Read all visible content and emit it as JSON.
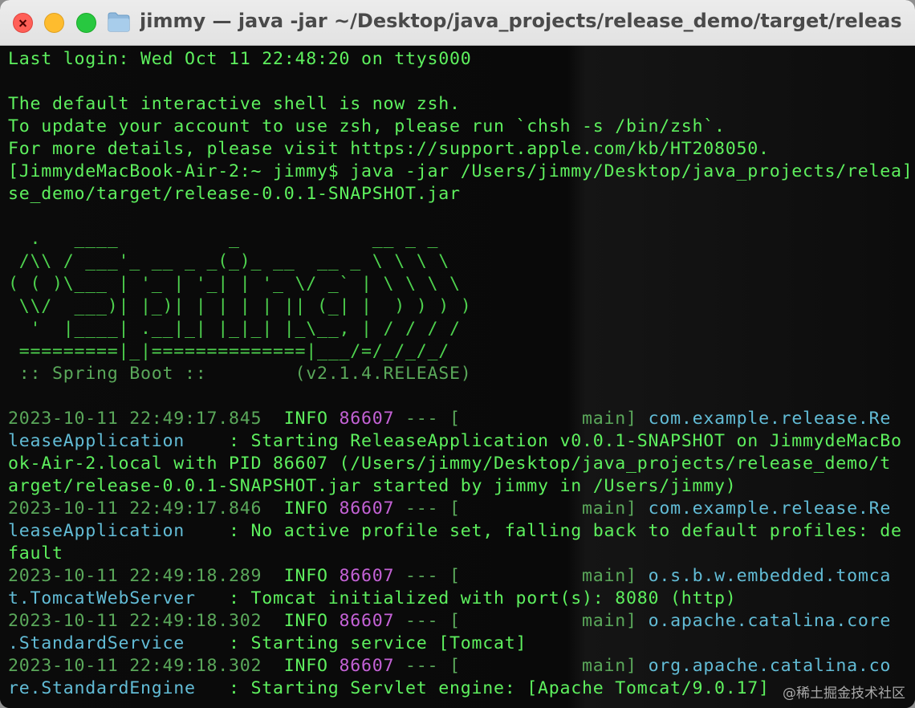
{
  "window": {
    "title": "jimmy — java -jar ~/Desktop/java_projects/release_demo/target/release-...",
    "controls": [
      "close",
      "minimize",
      "zoom"
    ]
  },
  "terminal": {
    "line_groups": [
      [
        {
          "t": "Last login: Wed Oct 11 22:48:20 on ttys000",
          "c": "green"
        }
      ],
      [
        {
          "t": "",
          "c": "green"
        }
      ],
      [
        {
          "t": "The default interactive shell is now zsh.",
          "c": "green"
        }
      ],
      [
        {
          "t": "To update your account to use zsh, please run `chsh -s /bin/zsh`.",
          "c": "green"
        }
      ],
      [
        {
          "t": "For more details, please visit https://support.apple.com/kb/HT208050.",
          "c": "green"
        }
      ],
      [
        {
          "t": "[JimmydeMacBook-Air-2:~ jimmy$ java -jar /Users/jimmy/Desktop/java_projects/relea]",
          "c": "green"
        }
      ],
      [
        {
          "t": "se_demo/target/release-0.0.1-SNAPSHOT.jar",
          "c": "green"
        }
      ],
      [
        {
          "t": "",
          "c": "green"
        }
      ],
      [
        {
          "t": "  .   ____          _            __ _ _",
          "c": "banner"
        }
      ],
      [
        {
          "t": " /\\\\ / ___'_ __ _ _(_)_ __  __ _ \\ \\ \\ \\",
          "c": "banner"
        }
      ],
      [
        {
          "t": "( ( )\\___ | '_ | '_| | '_ \\/ _` | \\ \\ \\ \\",
          "c": "banner"
        }
      ],
      [
        {
          "t": " \\\\/  ___)| |_)| | | | | || (_| |  ) ) ) )",
          "c": "banner"
        }
      ],
      [
        {
          "t": "  '  |____| .__|_| |_|_| |_\\__, | / / / /",
          "c": "banner"
        }
      ],
      [
        {
          "t": " =========|_|==============|___/=/_/_/_/",
          "c": "banner"
        }
      ],
      [
        {
          "t": " :: Spring Boot ::        (v2.1.4.RELEASE)",
          "c": "dim"
        }
      ],
      [
        {
          "t": "",
          "c": "green"
        }
      ],
      [
        {
          "t": "2023-10-11 22:49:17.845  ",
          "c": "dim"
        },
        {
          "t": "INFO ",
          "c": "green"
        },
        {
          "t": "86607",
          "c": "purple"
        },
        {
          "t": " --- [           main] ",
          "c": "dim"
        },
        {
          "t": "com.example.release.Re",
          "c": "cyan"
        }
      ],
      [
        {
          "t": "leaseApplication   ",
          "c": "cyan"
        },
        {
          "t": " : Starting ReleaseApplication v0.0.1-SNAPSHOT on JimmydeMacBo",
          "c": "green"
        }
      ],
      [
        {
          "t": "ok-Air-2.local with PID 86607 (/Users/jimmy/Desktop/java_projects/release_demo/t",
          "c": "green"
        }
      ],
      [
        {
          "t": "arget/release-0.0.1-SNAPSHOT.jar started by jimmy in /Users/jimmy)",
          "c": "green"
        }
      ],
      [
        {
          "t": "2023-10-11 22:49:17.846  ",
          "c": "dim"
        },
        {
          "t": "INFO ",
          "c": "green"
        },
        {
          "t": "86607",
          "c": "purple"
        },
        {
          "t": " --- [           main] ",
          "c": "dim"
        },
        {
          "t": "com.example.release.Re",
          "c": "cyan"
        }
      ],
      [
        {
          "t": "leaseApplication   ",
          "c": "cyan"
        },
        {
          "t": " : No active profile set, falling back to default profiles: de",
          "c": "green"
        }
      ],
      [
        {
          "t": "fault",
          "c": "green"
        }
      ],
      [
        {
          "t": "2023-10-11 22:49:18.289  ",
          "c": "dim"
        },
        {
          "t": "INFO ",
          "c": "green"
        },
        {
          "t": "86607",
          "c": "purple"
        },
        {
          "t": " --- [           main] ",
          "c": "dim"
        },
        {
          "t": "o.s.b.w.embedded.tomca",
          "c": "cyan"
        }
      ],
      [
        {
          "t": "t.TomcatWebServer  ",
          "c": "cyan"
        },
        {
          "t": " : Tomcat initialized with port(s): 8080 (http)",
          "c": "green"
        }
      ],
      [
        {
          "t": "2023-10-11 22:49:18.302  ",
          "c": "dim"
        },
        {
          "t": "INFO ",
          "c": "green"
        },
        {
          "t": "86607",
          "c": "purple"
        },
        {
          "t": " --- [           main] ",
          "c": "dim"
        },
        {
          "t": "o.apache.catalina.core",
          "c": "cyan"
        }
      ],
      [
        {
          "t": ".StandardService   ",
          "c": "cyan"
        },
        {
          "t": " : Starting service [Tomcat]",
          "c": "green"
        }
      ],
      [
        {
          "t": "2023-10-11 22:49:18.302  ",
          "c": "dim"
        },
        {
          "t": "INFO ",
          "c": "green"
        },
        {
          "t": "86607",
          "c": "purple"
        },
        {
          "t": " --- [           main] ",
          "c": "dim"
        },
        {
          "t": "org.apache.catalina.co",
          "c": "cyan"
        }
      ],
      [
        {
          "t": "re.StandardEngine  ",
          "c": "cyan"
        },
        {
          "t": " : Starting Servlet engine: [Apache Tomcat/9.0.17]",
          "c": "green"
        }
      ]
    ]
  },
  "watermark": "@稀土掘金技术社区",
  "colors": {
    "text_green": "#5ef05e",
    "dim_green": "#5aa85a",
    "pid_purple": "#c462d6",
    "logger_cyan": "#62bcd6",
    "background": "#0b0b0b"
  }
}
